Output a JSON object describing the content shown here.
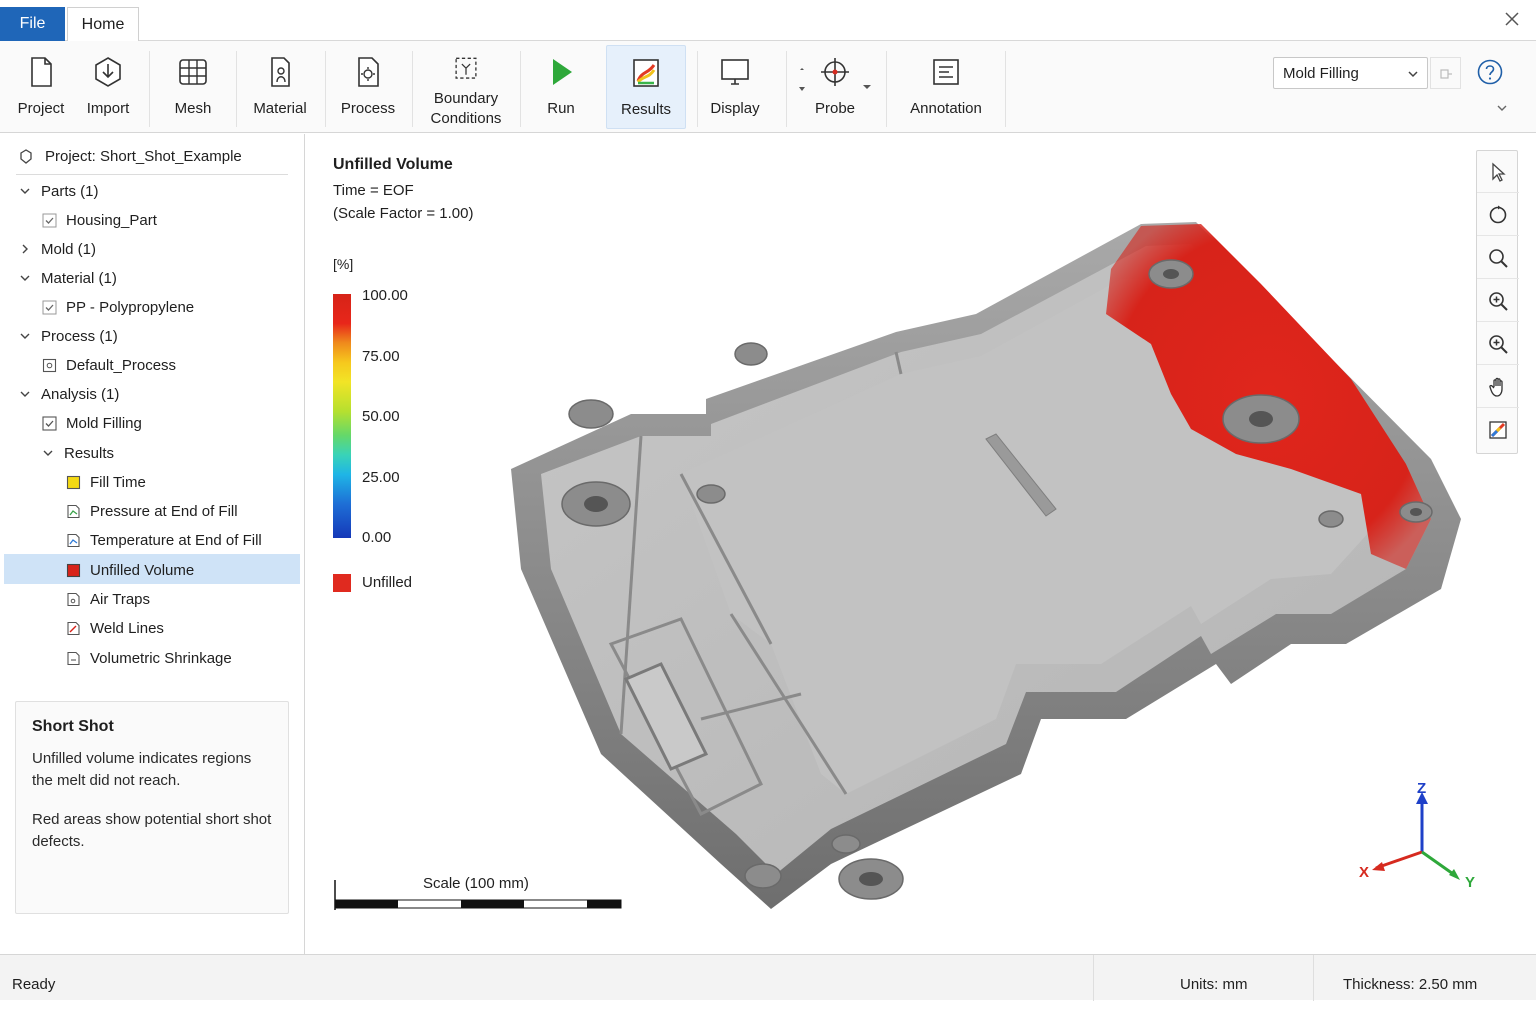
{
  "tabs": {
    "file": "File",
    "home": "Home"
  },
  "ribbon": {
    "project": "Project",
    "import": "Import",
    "mesh": "Mesh",
    "material": "Material",
    "process": "Process",
    "boundary_line1": "Boundary",
    "boundary_line2": "Conditions",
    "run": "Run",
    "results": "Results",
    "display": "Display",
    "probe": "Probe",
    "annotation": "Annotation",
    "analysis_select": "Mold Filling"
  },
  "tree": {
    "project": "Project: Short_Shot_Example",
    "parts": "Parts (1)",
    "housing": "Housing_Part",
    "mold": "Mold (1)",
    "material": "Material (1)",
    "pp": "PP - Polypropylene",
    "process": "Process (1)",
    "default_process": "Default_Process",
    "analysis": "Analysis (1)",
    "mold_filling": "Mold Filling",
    "results": "Results",
    "fill_time": "Fill Time",
    "pressure": "Pressure at End of Fill",
    "temperature": "Temperature at End of Fill",
    "unfilled": "Unfilled Volume",
    "air_traps": "Air Traps",
    "weld_lines": "Weld Lines",
    "shrinkage": "Volumetric Shrinkage"
  },
  "info": {
    "title": "Short Shot",
    "p1": "Unfilled volume indicates regions the melt did not reach.",
    "p2": "Red areas show potential short shot defects."
  },
  "viewport": {
    "title": "Unfilled Volume",
    "time": "Time = EOF",
    "scale_factor": "(Scale Factor = 1.00)",
    "unit": "[%]",
    "ticks": [
      "100.00",
      "75.00",
      "50.00",
      "25.00",
      "0.00"
    ],
    "unfilled_label": "Unfilled",
    "scale_bar": "Scale (100 mm)",
    "axis_x": "X",
    "axis_y": "Y",
    "axis_z": "Z"
  },
  "colors": {
    "accent": "#1f66b8",
    "unfilled": "#e02a1f",
    "selection": "#cfe3f7"
  },
  "status": {
    "ready": "Ready",
    "units": "Units:  mm",
    "thickness": "Thickness:  2.50 mm"
  }
}
